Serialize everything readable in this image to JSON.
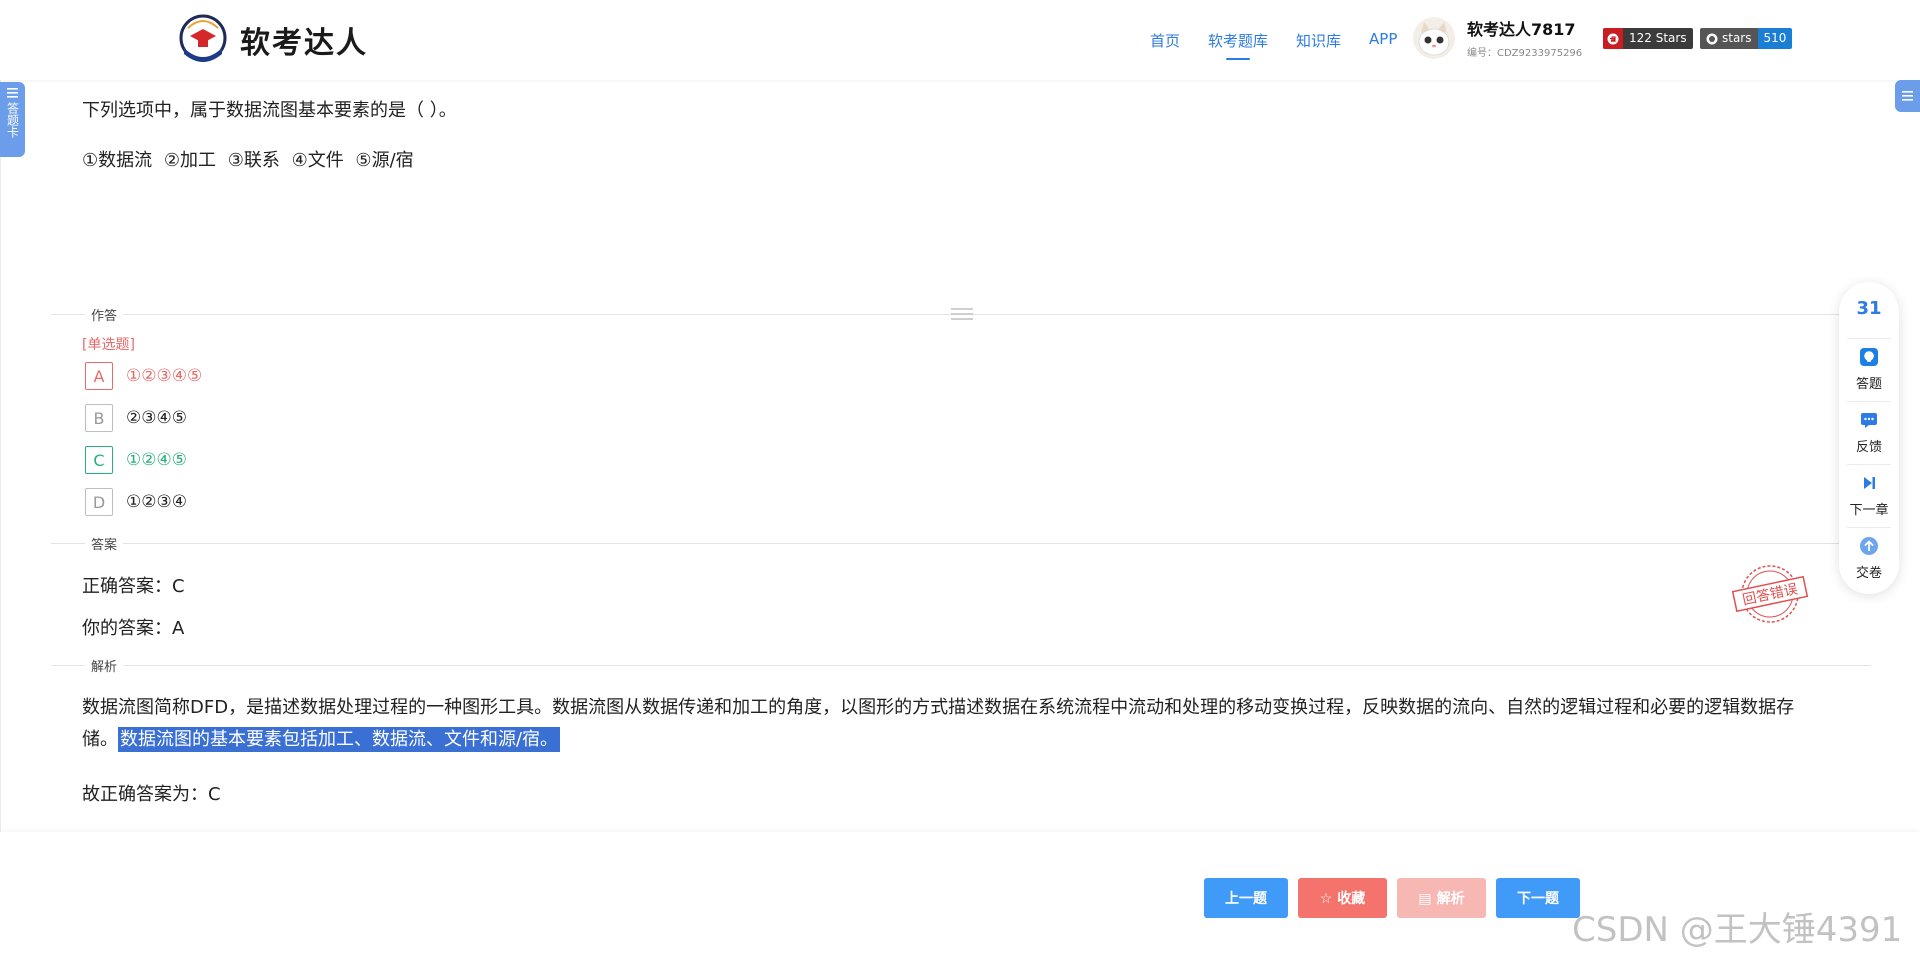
{
  "header": {
    "logo_text": "软考达人",
    "nav": [
      {
        "label": "首页",
        "active": false
      },
      {
        "label": "软考题库",
        "active": true
      },
      {
        "label": "知识库",
        "active": false
      },
      {
        "label": "APP",
        "active": false
      }
    ],
    "user": {
      "name": "软考达人7817",
      "id_text": "编号：CDZ9233975296"
    },
    "gitee_badge": "122 Stars",
    "github_badge": {
      "left": "stars",
      "right": "510"
    }
  },
  "left_tab": {
    "label": "答题卡"
  },
  "question": {
    "stem": "下列选项中，属于数据流图基本要素的是（ ）。",
    "items_line": "①数据流 ②加工 ③联系 ④文件 ⑤源/宿",
    "type_label": "[单选题]",
    "options": [
      {
        "key": "A",
        "text": "①②③④⑤",
        "state": "wrong"
      },
      {
        "key": "B",
        "text": "②③④⑤",
        "state": "normal"
      },
      {
        "key": "C",
        "text": "①②④⑤",
        "state": "correct"
      },
      {
        "key": "D",
        "text": "①②③④",
        "state": "normal"
      }
    ]
  },
  "sections": {
    "answer_section": "作答",
    "key_section": "答案",
    "analysis_section": "解析"
  },
  "answer": {
    "correct": "正确答案：C",
    "yours": "你的答案：A"
  },
  "analysis": {
    "text": "数据流图简称DFD，是描述数据处理过程的一种图形工具。数据流图从数据传递和加工的角度，以图形的方式描述数据在系统流程中流动和处理的移动变换过程，反映数据的流向、自然的逻辑过程和必要的逻辑数据存储。",
    "highlight": "数据流图的基本要素包括加工、数据流、文件和源/宿。",
    "conclusion": "故正确答案为：C"
  },
  "stamp_text": "回答错误",
  "side_tools": {
    "count": "31",
    "items": [
      {
        "label": "答题",
        "icon": "answer-icon"
      },
      {
        "label": "反馈",
        "icon": "feedback-icon"
      },
      {
        "label": "下一章",
        "icon": "next-chapter-icon"
      },
      {
        "label": "交卷",
        "icon": "submit-icon"
      }
    ]
  },
  "footer": {
    "prev": "上一题",
    "fav": "收藏",
    "analysis": "解析",
    "next": "下一题",
    "watermark": "CSDN @王大锤4391"
  },
  "colors": {
    "accent": "#2d7be5",
    "wrong": "#e86a6a",
    "correct": "#27b07a",
    "highlight": "#3a6fd4"
  }
}
